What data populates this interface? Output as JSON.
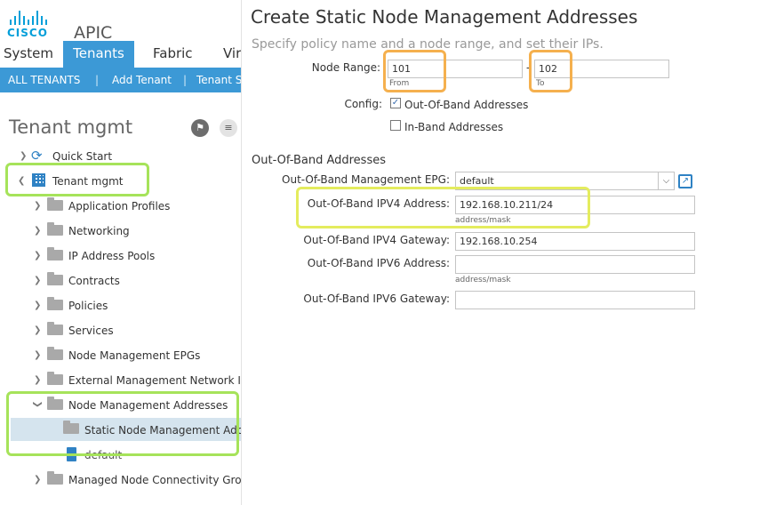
{
  "header": {
    "logo_text": "CISCO",
    "app_name": "APIC",
    "tabs": [
      "System",
      "Tenants",
      "Fabric",
      "Vir"
    ],
    "sub_nav": [
      "ALL TENANTS",
      "|",
      "Add Tenant",
      "|",
      "Tenant S"
    ]
  },
  "sidebar": {
    "title": "Tenant mgmt",
    "items": [
      {
        "label": "Quick Start",
        "icon": "quick-start-icon"
      },
      {
        "label": "Tenant mgmt",
        "icon": "tenant-grid-icon"
      },
      {
        "label": "Application Profiles",
        "icon": "folder-icon"
      },
      {
        "label": "Networking",
        "icon": "folder-icon"
      },
      {
        "label": "IP Address Pools",
        "icon": "folder-icon"
      },
      {
        "label": "Contracts",
        "icon": "folder-icon"
      },
      {
        "label": "Policies",
        "icon": "folder-icon"
      },
      {
        "label": "Services",
        "icon": "folder-icon"
      },
      {
        "label": "Node Management EPGs",
        "icon": "folder-icon"
      },
      {
        "label": "External Management Network Inst",
        "icon": "folder-icon"
      },
      {
        "label": "Node Management Addresses",
        "icon": "folder-icon"
      },
      {
        "label": "Static Node Management Addre",
        "icon": "folder-icon"
      },
      {
        "label": "default",
        "icon": "policy-icon"
      },
      {
        "label": "Managed Node Connectivity Group",
        "icon": "folder-icon"
      }
    ]
  },
  "form": {
    "title": "Create Static Node Management Addresses",
    "subtitle": "Specify policy name and a node range, and set their IPs.",
    "node_range_label": "Node Range:",
    "node_from": "101",
    "node_from_hint": "From",
    "node_to": "102",
    "node_to_hint": "To",
    "range_dash": "-",
    "config_label": "Config:",
    "config_oob": "Out-Of-Band Addresses",
    "config_oob_checked": true,
    "config_inband": "In-Band Addresses",
    "config_inband_checked": false,
    "section_title": "Out-Of-Band Addresses",
    "epg_label": "Out-Of-Band Management EPG:",
    "epg_value": "default",
    "ipv4_label": "Out-Of-Band IPV4 Address:",
    "ipv4_value": "192.168.10.211/24",
    "ipv4_hint": "address/mask",
    "ipv4_gw_label": "Out-Of-Band IPV4 Gateway:",
    "ipv4_gw_value": "192.168.10.254",
    "ipv6_label": "Out-Of-Band IPV6 Address:",
    "ipv6_value": "",
    "ipv6_hint": "address/mask",
    "ipv6_gw_label": "Out-Of-Band IPV6 Gateway:",
    "ipv6_gw_value": ""
  },
  "colors": {
    "accent": "#3c99d6",
    "cisco_blue": "#049fd9",
    "highlight_green": "#a6e35a",
    "highlight_yellow": "#e4ec5e",
    "highlight_orange": "#f5b04e",
    "selected_row": "#d5e4ee"
  }
}
